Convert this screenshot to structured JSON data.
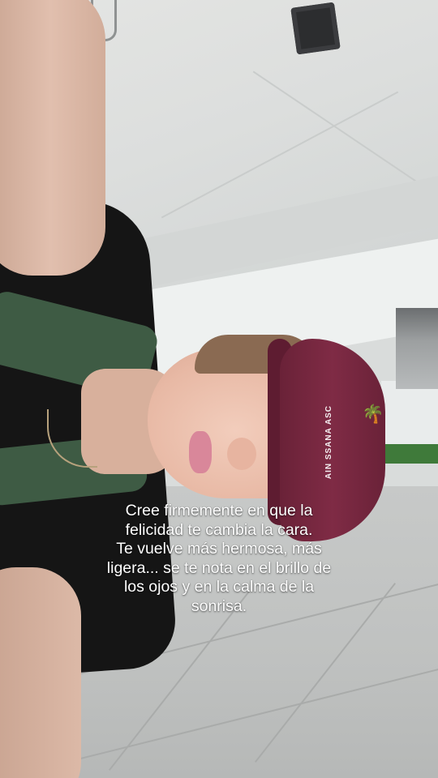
{
  "caption": {
    "lines": [
      "Cree firmemente en que la",
      "felicidad te cambia la cara.",
      "Te vuelve más hermosa, más",
      "ligera... se te nota en el brillo de",
      "los ojos y en la calma de la",
      "sonrisa."
    ]
  },
  "cap": {
    "text": "AIN SSANA ASC",
    "logo_icon": "palm-tree-icon"
  },
  "colors": {
    "cap": "#7f2b45",
    "shirt": "#151515",
    "strap": "#3e5b44",
    "caption_text": "#ffffff"
  }
}
